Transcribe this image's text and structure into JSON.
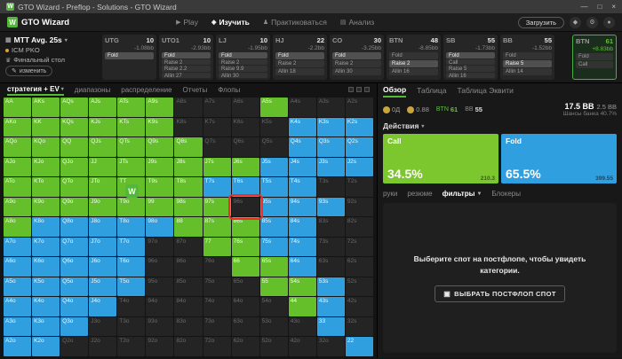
{
  "titlebar": {
    "title": "GTO Wizard - Preflop - Solutions - GTO Wizard",
    "logo_letter": "W",
    "controls": {
      "minimize": "—",
      "maximize": "□",
      "close": "×"
    }
  },
  "appbar": {
    "logo_letter": "W",
    "logo_text": "GTO Wizard",
    "nav": [
      {
        "id": "play",
        "icon": "▶",
        "label": "Play",
        "active": false
      },
      {
        "id": "study",
        "icon": "◈",
        "label": "Изучить",
        "active": true
      },
      {
        "id": "practice",
        "icon": "♟",
        "label": "Практиковаться",
        "active": false
      },
      {
        "id": "analyze",
        "icon": "▤",
        "label": "Анализ",
        "active": false
      }
    ],
    "upload_label": "Загрузить",
    "icons": [
      {
        "id": "premium",
        "glyph": "◆"
      },
      {
        "id": "settings",
        "glyph": "⚙"
      },
      {
        "id": "account",
        "glyph": "●"
      }
    ]
  },
  "config": {
    "format_icon": "▦",
    "format_label": "MTT Avg. 25s",
    "format_caret": "▾",
    "mode_label": "ICM PKO",
    "table_icon": "♛",
    "table_label": "Финальный стол",
    "edit_icon": "✎",
    "edit_label": "изменить",
    "cards": [
      {
        "pos": "UTG",
        "stack": "10",
        "ev": "-1.08bb",
        "actions": [
          {
            "label": "Fold",
            "active": true
          }
        ]
      },
      {
        "pos": "UTO1",
        "stack": "10",
        "ev": "-2.93bb",
        "actions": [
          {
            "label": "Fold",
            "active": true
          },
          {
            "label": "Raise 2"
          },
          {
            "label": "Raise 2.2"
          },
          {
            "label": "Allin 27"
          }
        ]
      },
      {
        "pos": "LJ",
        "stack": "10",
        "ev": "-1.95bb",
        "actions": [
          {
            "label": "Fold",
            "active": true
          },
          {
            "label": "Raise 2"
          },
          {
            "label": "Raise 9.9"
          },
          {
            "label": "Allin 30"
          }
        ]
      },
      {
        "pos": "HJ",
        "stack": "22",
        "ev": "-2.2bb",
        "actions": [
          {
            "label": "Fold",
            "active": true
          },
          {
            "label": "Raise 2"
          },
          {
            "label": "Allin 18"
          }
        ]
      },
      {
        "pos": "CO",
        "stack": "30",
        "ev": "-3.25bb",
        "actions": [
          {
            "label": "Fold",
            "active": true
          },
          {
            "label": "Raise 2"
          },
          {
            "label": "Allin 30"
          }
        ]
      },
      {
        "pos": "BTN",
        "stack": "48",
        "ev": "-8.85bb",
        "actions": [
          {
            "label": "Fold"
          },
          {
            "label": "Raise 2",
            "active": true
          },
          {
            "label": "Allin 16"
          }
        ]
      },
      {
        "pos": "SB",
        "stack": "55",
        "ev": "-1.73bb",
        "actions": [
          {
            "label": "Fold",
            "active": true
          },
          {
            "label": "Call"
          },
          {
            "label": "Raise 5"
          },
          {
            "label": "Allin 16"
          }
        ]
      },
      {
        "pos": "BB",
        "stack": "55",
        "ev": "-1.52bb",
        "actions": [
          {
            "label": "Fold"
          },
          {
            "label": "Raise 5",
            "active": true
          },
          {
            "label": "Allin 14"
          }
        ]
      }
    ],
    "hero_card": {
      "pos": "BTN",
      "stack": "61",
      "ev": "+8.83bb",
      "actions": [
        {
          "label": "Fold"
        },
        {
          "label": "Call"
        }
      ]
    }
  },
  "gridbar": {
    "tabs": [
      {
        "id": "strategy-ev",
        "label": "стратегия + EV",
        "active": true,
        "caret": "▾"
      },
      {
        "id": "ranges",
        "label": "диапазоны"
      },
      {
        "id": "distribution",
        "label": "распределение"
      },
      {
        "id": "reports",
        "label": "Отчеты"
      },
      {
        "id": "flops",
        "label": "Флопы"
      }
    ]
  },
  "grid": {
    "selected": "96s",
    "watermark_letter": "W",
    "color_map": {
      "g": "#65bf2a",
      "b": "#2f9fe0",
      "d": "#242424"
    },
    "rows": [
      [
        [
          "AA",
          "g"
        ],
        [
          "AKs",
          "g"
        ],
        [
          "AQs",
          "g"
        ],
        [
          "AJs",
          "g"
        ],
        [
          "ATs",
          "g"
        ],
        [
          "A9s",
          "g"
        ],
        [
          "A8s",
          "d"
        ],
        [
          "A7s",
          "d"
        ],
        [
          "A6s",
          "d"
        ],
        [
          "A5s",
          "g"
        ],
        [
          "A4s",
          "d"
        ],
        [
          "A3s",
          "d"
        ],
        [
          "A2s",
          "d"
        ]
      ],
      [
        [
          "AKo",
          "g"
        ],
        [
          "KK",
          "g"
        ],
        [
          "KQs",
          "g"
        ],
        [
          "KJs",
          "g"
        ],
        [
          "KTs",
          "g"
        ],
        [
          "K9s",
          "g"
        ],
        [
          "K8s",
          "d"
        ],
        [
          "K7s",
          "d"
        ],
        [
          "K6s",
          "d"
        ],
        [
          "K5s",
          "d"
        ],
        [
          "K4s",
          "b"
        ],
        [
          "K3s",
          "b"
        ],
        [
          "K2s",
          "b"
        ]
      ],
      [
        [
          "AQo",
          "g"
        ],
        [
          "KQo",
          "g"
        ],
        [
          "QQ",
          "g"
        ],
        [
          "QJs",
          "g"
        ],
        [
          "QTs",
          "g"
        ],
        [
          "Q9s",
          "g"
        ],
        [
          "Q8s",
          "g"
        ],
        [
          "Q7s",
          "d"
        ],
        [
          "Q6s",
          "d"
        ],
        [
          "Q5s",
          "d"
        ],
        [
          "Q4s",
          "b"
        ],
        [
          "Q3s",
          "b"
        ],
        [
          "Q2s",
          "b"
        ]
      ],
      [
        [
          "AJo",
          "g"
        ],
        [
          "KJo",
          "g"
        ],
        [
          "QJo",
          "g"
        ],
        [
          "JJ",
          "g"
        ],
        [
          "JTs",
          "g"
        ],
        [
          "J9s",
          "g"
        ],
        [
          "J8s",
          "g"
        ],
        [
          "J7s",
          "g"
        ],
        [
          "J6s",
          "g"
        ],
        [
          "J5s",
          "b"
        ],
        [
          "J4s",
          "b"
        ],
        [
          "J3s",
          "b"
        ],
        [
          "J2s",
          "b"
        ]
      ],
      [
        [
          "ATo",
          "g"
        ],
        [
          "KTo",
          "g"
        ],
        [
          "QTo",
          "g"
        ],
        [
          "JTo",
          "g"
        ],
        [
          "TT",
          "g"
        ],
        [
          "T9s",
          "g"
        ],
        [
          "T8s",
          "g"
        ],
        [
          "T7s",
          "b"
        ],
        [
          "T6s",
          "b"
        ],
        [
          "T5s",
          "b"
        ],
        [
          "T4s",
          "b"
        ],
        [
          "T3s",
          "d"
        ],
        [
          "T2s",
          "d"
        ]
      ],
      [
        [
          "A9o",
          "g"
        ],
        [
          "K9o",
          "g"
        ],
        [
          "Q9o",
          "g"
        ],
        [
          "J9o",
          "g"
        ],
        [
          "T9o",
          "g"
        ],
        [
          "99",
          "g"
        ],
        [
          "98s",
          "g"
        ],
        [
          "97s",
          "g"
        ],
        [
          "96s",
          "d"
        ],
        [
          "95s",
          "b"
        ],
        [
          "94s",
          "b"
        ],
        [
          "93s",
          "b"
        ],
        [
          "92s",
          "d"
        ]
      ],
      [
        [
          "A8o",
          "g"
        ],
        [
          "K8o",
          "b"
        ],
        [
          "Q8o",
          "b"
        ],
        [
          "J8o",
          "b"
        ],
        [
          "T8o",
          "b"
        ],
        [
          "98o",
          "b"
        ],
        [
          "88",
          "g"
        ],
        [
          "87s",
          "g"
        ],
        [
          "86s",
          "g"
        ],
        [
          "85s",
          "b"
        ],
        [
          "84s",
          "b"
        ],
        [
          "83s",
          "d"
        ],
        [
          "82s",
          "d"
        ]
      ],
      [
        [
          "A7o",
          "b"
        ],
        [
          "K7o",
          "b"
        ],
        [
          "Q7o",
          "b"
        ],
        [
          "J7o",
          "b"
        ],
        [
          "T7o",
          "b"
        ],
        [
          "97o",
          "d"
        ],
        [
          "87o",
          "d"
        ],
        [
          "77",
          "g"
        ],
        [
          "76s",
          "g"
        ],
        [
          "75s",
          "b"
        ],
        [
          "74s",
          "b"
        ],
        [
          "73s",
          "d"
        ],
        [
          "72s",
          "d"
        ]
      ],
      [
        [
          "A6o",
          "b"
        ],
        [
          "K6o",
          "b"
        ],
        [
          "Q6o",
          "b"
        ],
        [
          "J6o",
          "b"
        ],
        [
          "T6o",
          "b"
        ],
        [
          "96o",
          "d"
        ],
        [
          "86o",
          "d"
        ],
        [
          "76o",
          "d"
        ],
        [
          "66",
          "g"
        ],
        [
          "65s",
          "g"
        ],
        [
          "64s",
          "b"
        ],
        [
          "63s",
          "d"
        ],
        [
          "62s",
          "d"
        ]
      ],
      [
        [
          "A5o",
          "b"
        ],
        [
          "K5o",
          "b"
        ],
        [
          "Q5o",
          "b"
        ],
        [
          "J5o",
          "b"
        ],
        [
          "T5o",
          "b"
        ],
        [
          "95o",
          "d"
        ],
        [
          "85o",
          "d"
        ],
        [
          "75o",
          "d"
        ],
        [
          "65o",
          "d"
        ],
        [
          "55",
          "g"
        ],
        [
          "54s",
          "g"
        ],
        [
          "53s",
          "b"
        ],
        [
          "52s",
          "d"
        ]
      ],
      [
        [
          "A4o",
          "b"
        ],
        [
          "K4o",
          "b"
        ],
        [
          "Q4o",
          "b"
        ],
        [
          "J4o",
          "b"
        ],
        [
          "T4o",
          "d"
        ],
        [
          "94o",
          "d"
        ],
        [
          "84o",
          "d"
        ],
        [
          "74o",
          "d"
        ],
        [
          "64o",
          "d"
        ],
        [
          "54o",
          "d"
        ],
        [
          "44",
          "g"
        ],
        [
          "43s",
          "b"
        ],
        [
          "42s",
          "d"
        ]
      ],
      [
        [
          "A3o",
          "b"
        ],
        [
          "K3o",
          "b"
        ],
        [
          "Q3o",
          "b"
        ],
        [
          "J3o",
          "d"
        ],
        [
          "T3o",
          "d"
        ],
        [
          "93o",
          "d"
        ],
        [
          "83o",
          "d"
        ],
        [
          "73o",
          "d"
        ],
        [
          "63o",
          "d"
        ],
        [
          "53o",
          "d"
        ],
        [
          "43o",
          "d"
        ],
        [
          "33",
          "b"
        ],
        [
          "32s",
          "d"
        ]
      ],
      [
        [
          "A2o",
          "b"
        ],
        [
          "K2o",
          "b"
        ],
        [
          "Q2o",
          "d"
        ],
        [
          "J2o",
          "d"
        ],
        [
          "T2o",
          "d"
        ],
        [
          "92o",
          "d"
        ],
        [
          "82o",
          "d"
        ],
        [
          "72o",
          "d"
        ],
        [
          "62o",
          "d"
        ],
        [
          "52o",
          "d"
        ],
        [
          "42o",
          "d"
        ],
        [
          "32o",
          "d"
        ],
        [
          "22",
          "b"
        ]
      ]
    ]
  },
  "panel": {
    "tabs": [
      {
        "id": "overview",
        "label": "Обзор",
        "active": true
      },
      {
        "id": "table",
        "label": "Таблица"
      },
      {
        "id": "equity-table",
        "label": "Таблица Эквити"
      }
    ],
    "stats": {
      "chips": [
        {
          "value": "0Д"
        },
        {
          "value": "0.88"
        }
      ],
      "players": [
        {
          "pos": "BTN",
          "stack": "61"
        },
        {
          "pos": "BB",
          "stack": "55"
        }
      ],
      "pot": "17.5 BB",
      "to_call": "2.5 BB",
      "odds_label": "Шансы банка",
      "odds_value": "40.7%"
    },
    "actions_label": "Действия",
    "actions_caret": "▾",
    "bars": [
      {
        "id": "call",
        "label": "Call",
        "pct": "34.5%",
        "combos": "210.3",
        "color": "#7cc62e"
      },
      {
        "id": "fold",
        "label": "Fold",
        "pct": "65.5%",
        "combos": "399.55",
        "color": "#2f9fdf"
      }
    ],
    "subtabs": [
      {
        "id": "hands",
        "label": "руки"
      },
      {
        "id": "summary",
        "label": "резюме"
      },
      {
        "id": "filters",
        "label": "фильтры",
        "active": true,
        "icon": "funnel"
      },
      {
        "id": "blockers",
        "label": "Блокеры"
      }
    ],
    "postflop": {
      "message": "Выберите спот на постфлопе, чтобы увидеть категории.",
      "button_icon": "▣",
      "button_label": "ВЫБРАТЬ ПОСТФЛОП СПОТ"
    }
  }
}
